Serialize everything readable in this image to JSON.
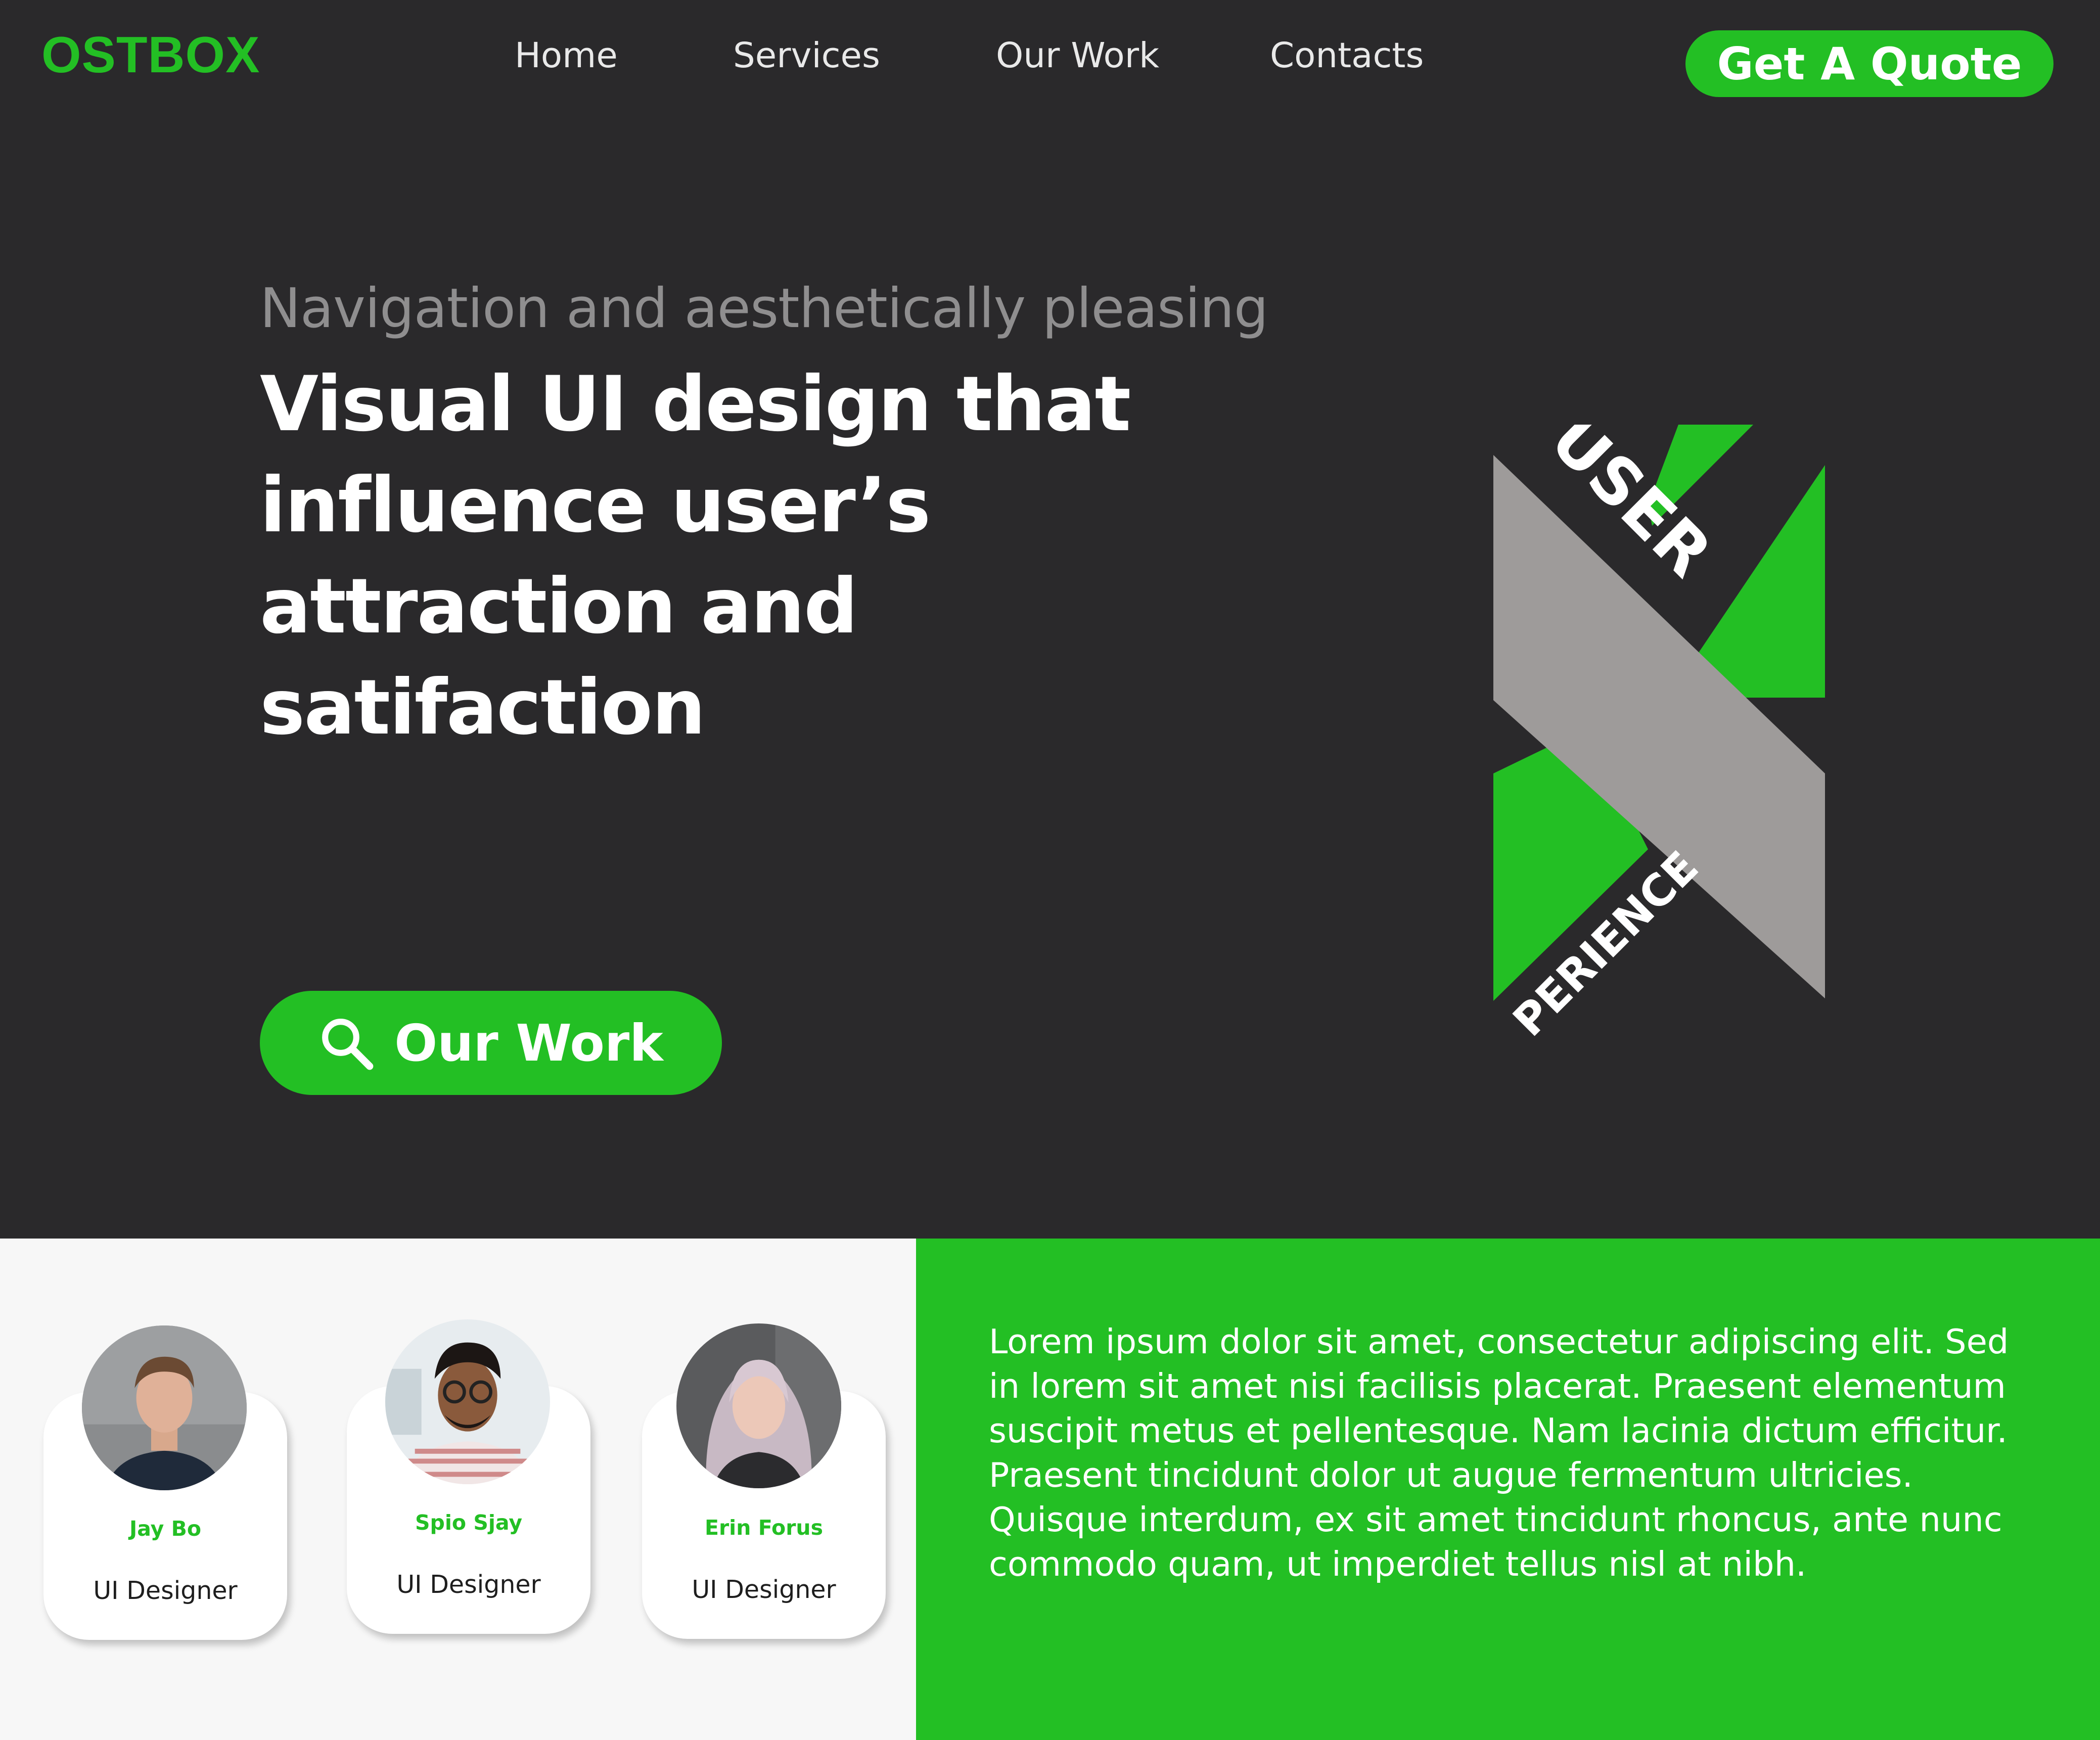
{
  "brand": {
    "logo": "OSTBOX",
    "accent": "#23bf24",
    "background": "#2a292b"
  },
  "nav": {
    "items": [
      "Home",
      "Services",
      "Our Work",
      "Contacts"
    ]
  },
  "header": {
    "cta_label": "Get A Quote"
  },
  "hero": {
    "subtitle": "Navigation and aesthetically pleasing",
    "headline": "Visual UI design that influence user’s attraction and satifaction",
    "button_label": "Our Work",
    "button_icon": "search-icon",
    "graphic": {
      "top_text": "USER",
      "bottom_text": "PERIENCE"
    }
  },
  "team": {
    "members": [
      {
        "name": "Jay Bo",
        "role": "UI Designer"
      },
      {
        "name": "Spio Sjay",
        "role": "UI Designer"
      },
      {
        "name": "Erin Forus",
        "role": "UI Designer"
      }
    ]
  },
  "info": {
    "text": "Lorem ipsum dolor sit amet, consectetur adipiscing elit. Sed in lorem sit amet nisi facilisis placerat. Praesent elementum suscipit metus et pellentesque. Nam lacinia dictum efficitur. Praesent tincidunt dolor ut augue fermentum ultricies. Quisque interdum, ex sit amet tincidunt rhoncus, ante nunc commodo quam, ut imperdiet tellus nisl at nibh."
  }
}
